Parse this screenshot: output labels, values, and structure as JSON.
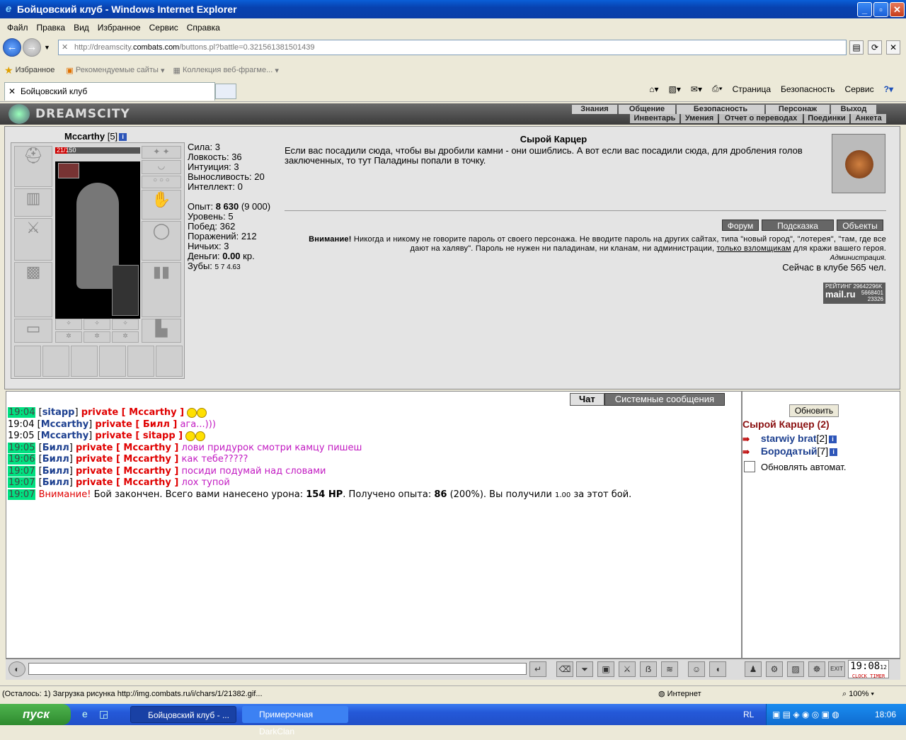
{
  "window": {
    "title": "Бойцовский клуб - Windows Internet Explorer"
  },
  "menu": [
    "Файл",
    "Правка",
    "Вид",
    "Избранное",
    "Сервис",
    "Справка"
  ],
  "address": {
    "prefix": "http://dreamscity.",
    "domain": "combats.com",
    "suffix": "/buttons.pl?battle=0.321561381501439"
  },
  "favorites": {
    "label": "Избранное",
    "suggested": "Рекомендуемые сайты",
    "webslice": "Коллекция веб-фрагме..."
  },
  "tab": {
    "label": "Бойцовский клуб"
  },
  "commands": [
    "Страница",
    "Безопасность",
    "Сервис"
  ],
  "game": {
    "logo": "DREAMSCITY",
    "nav_top": [
      "Знания",
      "Общение",
      "Безопасность",
      "Персонаж",
      "Выход"
    ],
    "nav_bottom": [
      "Инвентарь",
      "Умения",
      "Отчет о переводах",
      "Поединки",
      "Анкета"
    ],
    "char": {
      "name": "Mccarthy",
      "level": "[5]",
      "hp_text": "21/150",
      "hp_fraction": 0.14
    },
    "stats": [
      {
        "label": "Сила:",
        "value": "3"
      },
      {
        "label": "Ловкость:",
        "value": "36"
      },
      {
        "label": "Интуиция:",
        "value": "3"
      },
      {
        "label": "Выносливость:",
        "value": "20"
      },
      {
        "label": "Интеллект:",
        "value": "0"
      }
    ],
    "exp": {
      "label": "Опыт:",
      "value": "8 630",
      "next": "(9 000)"
    },
    "stats2": [
      {
        "label": "Уровень:",
        "value": "5"
      },
      {
        "label": "Побед:",
        "value": "362"
      },
      {
        "label": "Поражений:",
        "value": "212"
      },
      {
        "label": "Ничьих:",
        "value": "3"
      }
    ],
    "money": {
      "label": "Деньги:",
      "value": "0.00",
      "unit": "кр."
    },
    "teeth": {
      "label": "Зубы:",
      "value": "5 7 4.63"
    },
    "room_title": "Сырой Карцер",
    "room_desc": "Если вас посадили сюда, чтобы вы дробили камни - они ошиблись. А вот если вас посадили сюда, для дробления голов заключенных, то тут Паладины попали в точку.",
    "buttons": [
      "Форум",
      "Подсказка",
      "Объекты"
    ],
    "warning_bold": "Внимание!",
    "warning_text": "Никогда и никому не говорите пароль от своего персонажа. Не вводите пароль на других сайтах, типа \"новый город\", \"лотерея\", \"там, где все дают на халяву\". Пароль не нужен ни паладинам, ни кланам, ни администрации,",
    "warning_link": "только взломщикам",
    "warning_end": "для кражи вашего героя.",
    "admin": "Администрация.",
    "online": "Сейчас в клубе 565 чел.",
    "rating": {
      "line1": "РЕЙТИНГ 29642296K",
      "logo": "mail.ru",
      "n1": "5668401",
      "n2": "23326"
    }
  },
  "chat": {
    "tab_chat": "Чат",
    "tab_system": "Системные сообщения",
    "lines": [
      {
        "time": "19:04",
        "hl": true,
        "from": "sitapp",
        "to": "Mccarthy",
        "msg": "",
        "smile": true
      },
      {
        "time": "19:04",
        "hl": false,
        "from": "Mccarthy",
        "to": "Билл",
        "msg": "ага...)))",
        "smile": false
      },
      {
        "time": "19:05",
        "hl": false,
        "from": "Mccarthy",
        "to": "sitapp",
        "msg": "",
        "smile": true
      },
      {
        "time": "19:05",
        "hl": true,
        "from": "Билл",
        "to": "Mccarthy",
        "msg": "лови придурок смотри камцу пишеш",
        "smile": false
      },
      {
        "time": "19:06",
        "hl": true,
        "from": "Билл",
        "to": "Mccarthy",
        "msg": "как тебе?????",
        "smile": false
      },
      {
        "time": "19:07",
        "hl": true,
        "from": "Билл",
        "to": "Mccarthy",
        "msg": "посиди подумай над словами",
        "smile": false
      },
      {
        "time": "19:07",
        "hl": true,
        "from": "Билл",
        "to": "Mccarthy",
        "msg": "лох тупой",
        "smile": false
      }
    ],
    "private_word": "private",
    "sys": {
      "time": "19:07",
      "warn": "Внимание!",
      "t1": "Бой закончен. Всего вами нанесено урона:",
      "dmg": "154 HP",
      "t2": ". Получено опыта:",
      "exp": "86",
      "t3": "(200%). Вы получили",
      "teeth": "1.00",
      "t4": "за этот бой."
    }
  },
  "sidebar": {
    "refresh": "Обновить",
    "room": "Сырой Карцер (2)",
    "players": [
      {
        "name": "starwiy brat",
        "level": "[2]"
      },
      {
        "name": "Бородатый",
        "level": "[7]"
      }
    ],
    "auto": "Обновлять автомат."
  },
  "clock": {
    "time": "19:08",
    "sec": "12",
    "lbl1": "CLOCK",
    "lbl2": "TIMER"
  },
  "status": {
    "text": "(Осталось: 1) Загрузка рисунка http://img.combats.ru/i/chars/1/21382.gif...",
    "zone": "Интернет",
    "zoom": "100%"
  },
  "taskbar": {
    "start": "пуск",
    "task1": "Бойцовский клуб - ...",
    "task2": "Примерочная DarkClan",
    "lang": "RL",
    "time": "18:06"
  }
}
